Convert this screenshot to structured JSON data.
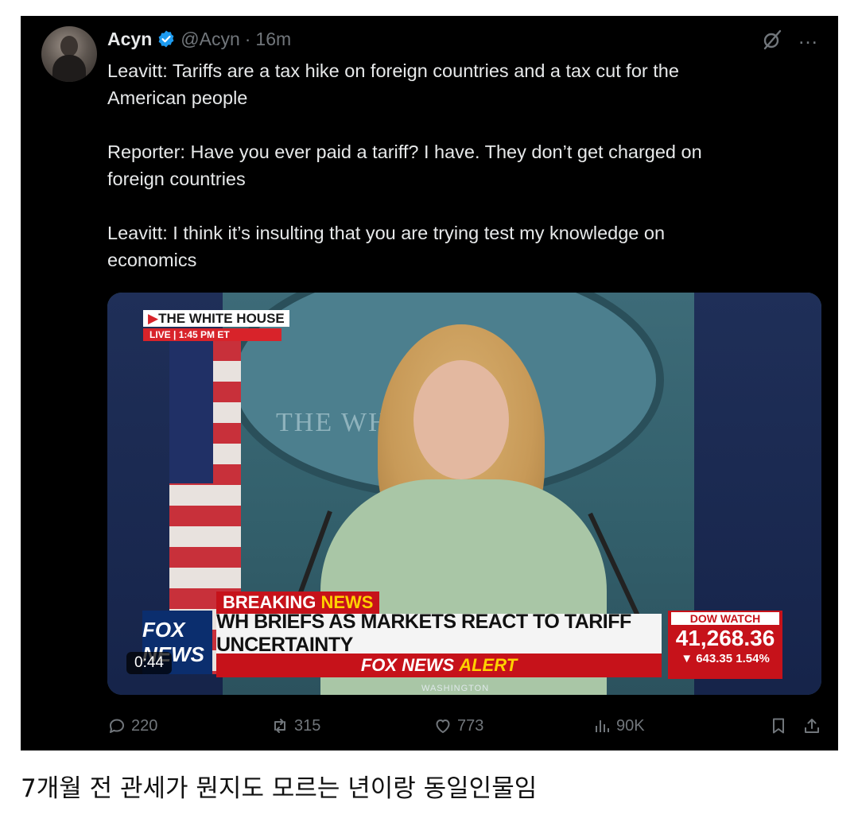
{
  "tweet": {
    "author_name": "Acyn",
    "handle": "@Acyn",
    "separator": "·",
    "time": "16m",
    "text": "Leavitt: Tariffs are a tax hike on foreign countries and a tax cut for the\nAmerican people\n\nReporter: Have you ever paid a tariff? I have. They don’t get charged on\nforeign countries\n\nLeavitt: I think it’s insulting that you are trying test my knowledge on\neconomics",
    "icons": [
      "verified-badge-icon",
      "grok-icon",
      "more-icon"
    ],
    "colors": {
      "background": "#000000",
      "text": "#e7e9ea",
      "muted": "#71767b",
      "verified": "#1d9bf0"
    }
  },
  "video": {
    "duration": "0:44",
    "broadcast": {
      "location_tag": "THE WHITE HOUSE",
      "live_label": "LIVE | 1:45 PM ET",
      "seal_text": "THE WH     USE",
      "breaking_1": "BREAKING",
      "breaking_2": "NEWS",
      "headline": "WH BRIEFS AS MARKETS REACT TO TARIFF UNCERTAINTY",
      "alert_1": "FOX NEWS",
      "alert_2": "ALERT",
      "channel_logo": "FOX NEWS",
      "dow_label": "DOW WATCH",
      "dow_value": "41,268.36",
      "dow_change": "▼ 643.35 1.54%",
      "dateline": "WASHINGTON"
    }
  },
  "actions": {
    "replies": "220",
    "reposts": "315",
    "likes": "773",
    "views": "90K",
    "icons": [
      "reply-icon",
      "repost-icon",
      "like-icon",
      "views-icon",
      "bookmark-icon",
      "share-icon"
    ]
  },
  "caption": "7개월 전 관세가 뭔지도 모르는 년이랑 동일인물임"
}
